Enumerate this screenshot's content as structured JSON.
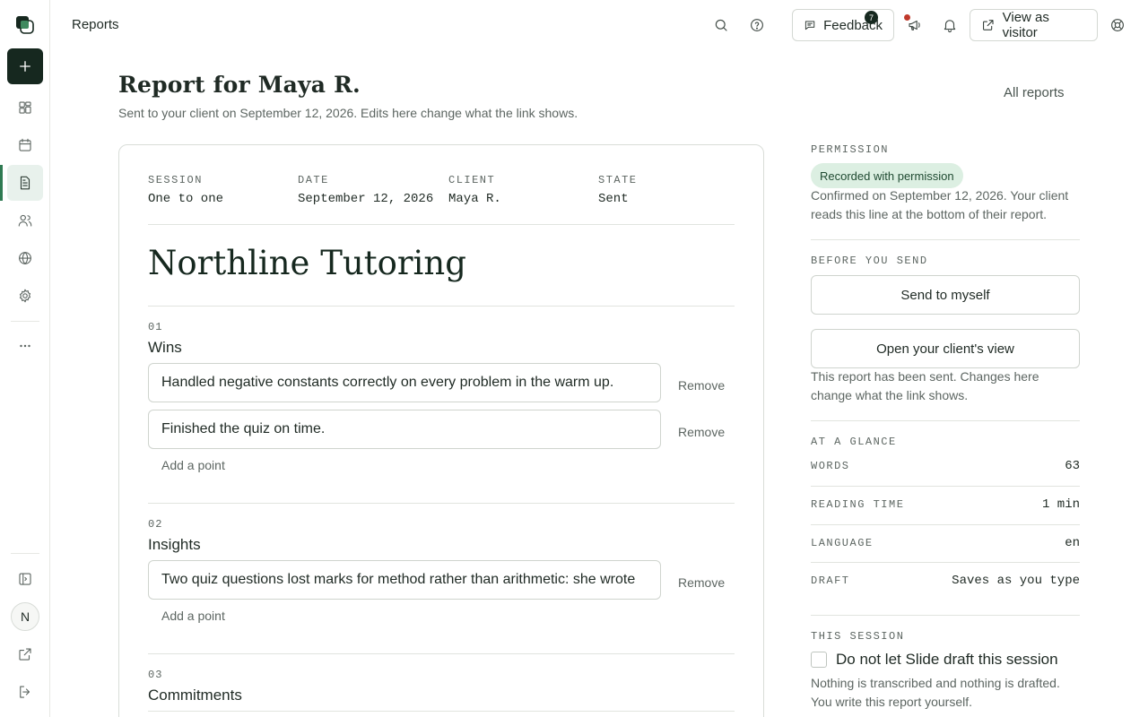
{
  "rail": {
    "logo": "app-logo-icon",
    "items": [
      "plus-icon",
      "dashboard-icon",
      "calendar-icon",
      "document-icon",
      "users-icon",
      "globe-icon",
      "gear-icon",
      "more-icon"
    ],
    "bottom": [
      "sidebar-toggle-icon",
      "external-link-icon",
      "logout-icon"
    ],
    "avatar_initial": "N"
  },
  "topbar": {
    "title": "Reports",
    "feedback_label": "Feedback",
    "announcements_count": "7",
    "view_as_visitor_label": "View as visitor"
  },
  "page": {
    "title": "Report for Maya R.",
    "subtitle": "Sent to your client on September 12, 2026. Edits here change what the link shows.",
    "all_reports_link": "All reports"
  },
  "report": {
    "meta": [
      {
        "label": "SESSION",
        "value": "One to one"
      },
      {
        "label": "DATE",
        "value": "September 12, 2026"
      },
      {
        "label": "CLIENT",
        "value": "Maya R."
      },
      {
        "label": "STATE",
        "value": "Sent"
      }
    ],
    "brand": "Northline Tutoring",
    "remove_label": "Remove",
    "add_point_label": "Add a point",
    "sections": [
      {
        "number": "01",
        "title": "Wins",
        "points": [
          "Handled negative constants correctly on every problem in the warm up.",
          "Finished the quiz on time."
        ]
      },
      {
        "number": "02",
        "title": "Insights",
        "points": [
          "Two quiz questions lost marks for method rather than arithmetic: she wrote"
        ]
      },
      {
        "number": "03",
        "title": "Commitments",
        "points": []
      }
    ]
  },
  "panel": {
    "permission": {
      "label": "PERMISSION",
      "pill": "Recorded with permission",
      "text": "Confirmed on September 12, 2026. Your client reads this line at the bottom of their report."
    },
    "before_send": {
      "label": "BEFORE YOU SEND",
      "send_myself": "Send to myself",
      "open_client_view": "Open your client's view",
      "text": "This report has been sent. Changes here change what the link shows."
    },
    "glance": {
      "label": "AT A GLANCE",
      "rows": [
        {
          "key": "WORDS",
          "value": "63"
        },
        {
          "key": "READING TIME",
          "value": "1 min"
        },
        {
          "key": "LANGUAGE",
          "value": "en"
        },
        {
          "key": "DRAFT",
          "value": "Saves as you type"
        }
      ]
    },
    "session": {
      "label": "THIS SESSION",
      "checkbox_label": "Do not let Slide draft this session",
      "checked": false,
      "text": "Nothing is transcribed and nothing is drafted. You write this report yourself."
    }
  }
}
